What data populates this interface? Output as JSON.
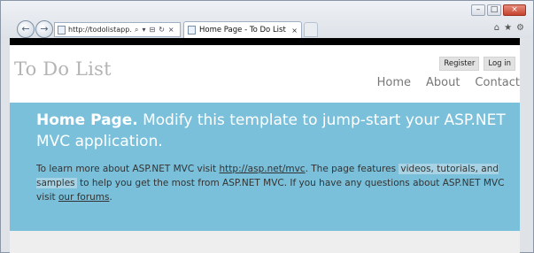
{
  "browser": {
    "address_text": "http://todolistapp...",
    "tab_title": "Home Page - To Do List",
    "win_min": "–",
    "win_max": "□",
    "win_close": "×",
    "back_icon": "←",
    "forward_icon": "→",
    "addr_icons": [
      "⌕",
      "▾",
      "⊟",
      "↻",
      "×"
    ],
    "right_icons": [
      "⌂",
      "★",
      "⚙"
    ],
    "tab_close": "×"
  },
  "site": {
    "title": "To Do List",
    "login_links": [
      "Register",
      "Log in"
    ],
    "menu": [
      "Home",
      "About",
      "Contact"
    ]
  },
  "featured": {
    "heading_bold": "Home Page.",
    "heading_rest": "Modify this template to jump-start your ASP.NET MVC application.",
    "intro_1": "To learn more about ASP.NET MVC visit ",
    "link_1": "http://asp.net/mvc",
    "intro_2": ". The page features ",
    "highlight_1": "videos, tutorials, and samples",
    "intro_3": " to help you get the most from ASP.NET MVC. If you have any questions about ASP.NET MVC visit ",
    "link_2": "our forums",
    "intro_4": "."
  },
  "colors": {
    "featured_bg": "#7ac0da",
    "title_color": "#b4b4b4",
    "menu_color": "#777777"
  }
}
